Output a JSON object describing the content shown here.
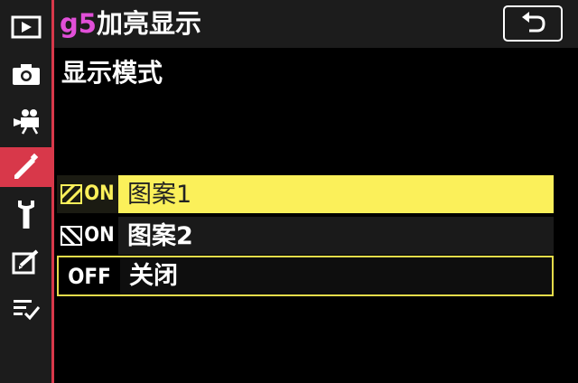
{
  "header": {
    "code": "g5",
    "title": "加亮显示",
    "back_icon": "return-arrow-icon"
  },
  "subtitle": "显示模式",
  "sidebar": {
    "items": [
      {
        "name": "playback-menu",
        "icon": "play-icon",
        "active": false
      },
      {
        "name": "photo-shooting-menu",
        "icon": "camera-icon",
        "active": false
      },
      {
        "name": "movie-shooting-menu",
        "icon": "movie-camera-icon",
        "active": false
      },
      {
        "name": "custom-settings-menu",
        "icon": "pencil-icon",
        "active": true
      },
      {
        "name": "setup-menu",
        "icon": "wrench-icon",
        "active": false
      },
      {
        "name": "retouch-menu",
        "icon": "retouch-icon",
        "active": false
      },
      {
        "name": "my-menu",
        "icon": "checklist-icon",
        "active": false
      }
    ]
  },
  "options": [
    {
      "badge": "ON",
      "badge_icon": "hatch-pattern-1-icon",
      "label": "图案1",
      "selected": true
    },
    {
      "badge": "ON",
      "badge_icon": "hatch-pattern-2-icon",
      "label": "图案2",
      "selected": false
    },
    {
      "badge": "OFF",
      "label": "关闭",
      "selected": false,
      "current": true
    }
  ],
  "colors": {
    "accent": "#d8384a",
    "highlight": "#fbf05a",
    "title_code": "#e14fd8",
    "current_border": "#e5dc4a"
  }
}
